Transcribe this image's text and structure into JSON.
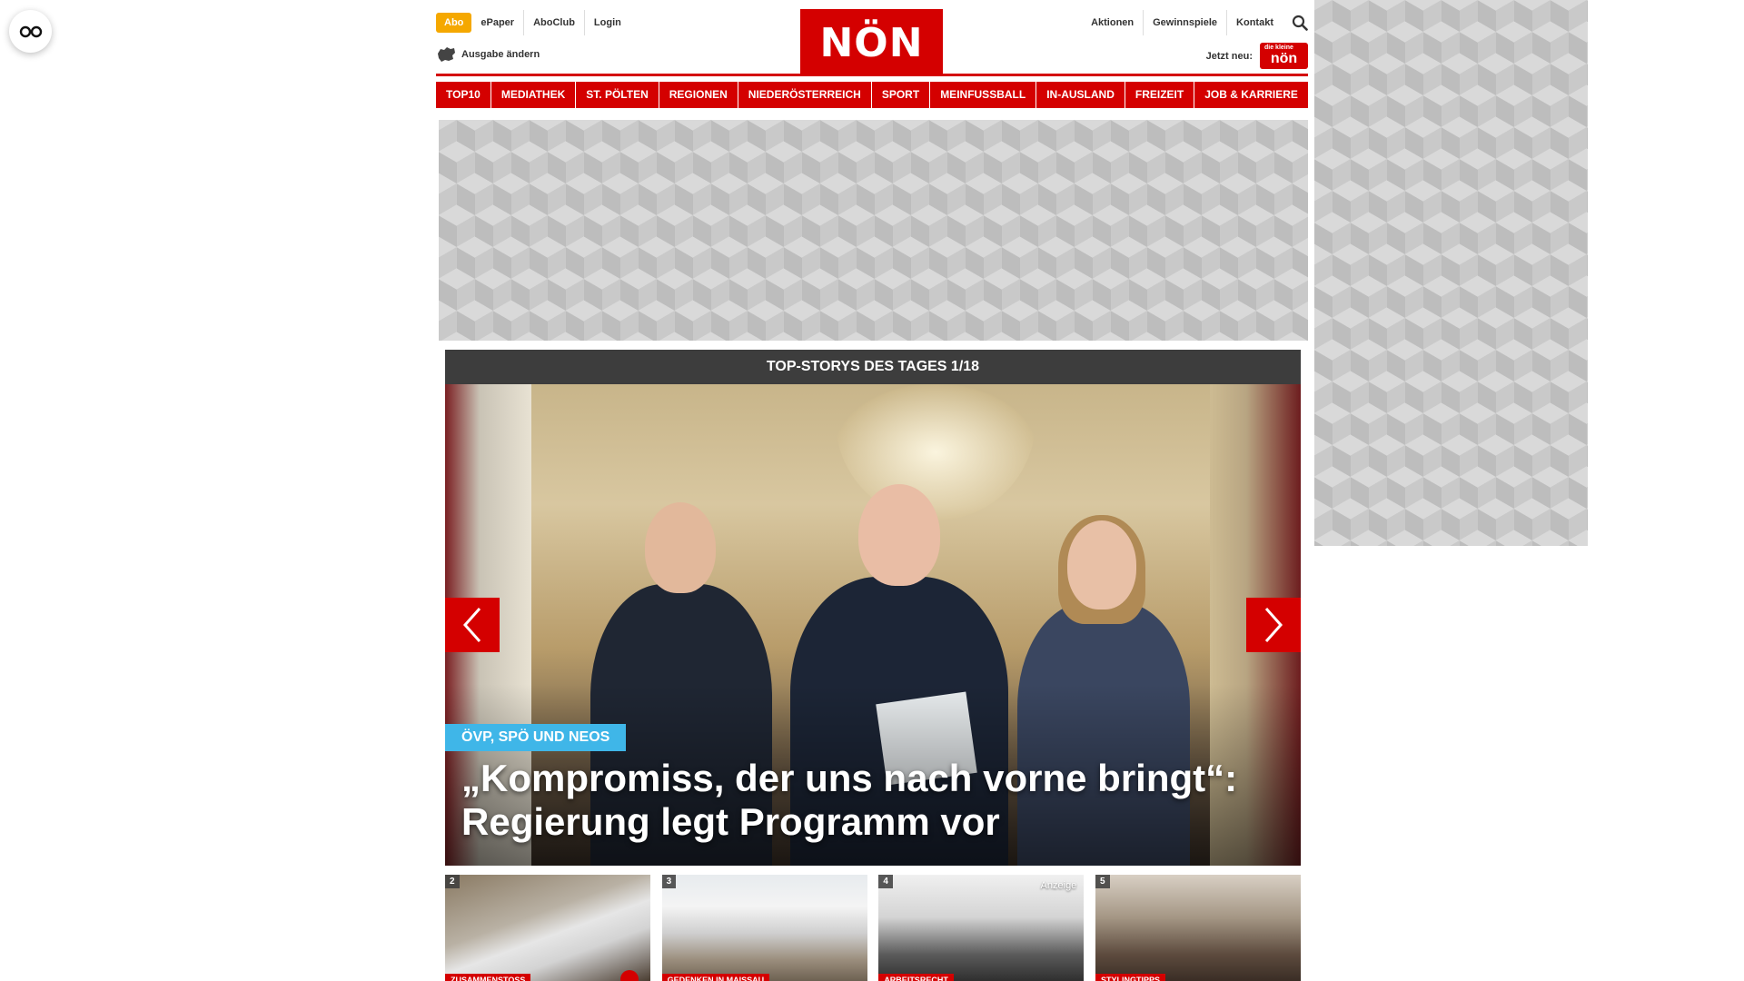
{
  "floating": {
    "icon": "reader-glasses-icon"
  },
  "header": {
    "abo_label": "Abo",
    "left_links": [
      "ePaper",
      "AboClub",
      "Login"
    ],
    "ausgabe_label": "Ausgabe ändern",
    "logo_text": "NÖN",
    "right_links": [
      "Aktionen",
      "Gewinnspiele",
      "Kontakt"
    ],
    "jetzt_label": "Jetzt neu:",
    "mini_logo_small": "die kleine",
    "mini_logo_text": "nön",
    "accent_color": "#d40000",
    "abo_color": "#f5a800"
  },
  "nav": {
    "items": [
      "TOP10",
      "MEDIATHEK",
      "ST. PÖLTEN",
      "REGIONEN",
      "NIEDERÖSTERREICH",
      "SPORT",
      "MEINFUSSBALL",
      "IN-AUSLAND",
      "FREIZEIT",
      "JOB & KARRIERE"
    ]
  },
  "stories": {
    "heading": "TOP-STORYS DES TAGES 1/18",
    "hero": {
      "tag": "ÖVP, SPÖ UND NEOS",
      "title": "„Kompromiss, der uns nach vorne bringt“: Regierung legt Programm vor",
      "tag_color": "#3fb6e8"
    },
    "thumbs": [
      {
        "num": "2",
        "category": "ZUSAMMENSTOSS",
        "ad": ""
      },
      {
        "num": "3",
        "category": "GEDENKEN IN MAISSAU",
        "ad": ""
      },
      {
        "num": "4",
        "category": "ARBEITSRECHT",
        "ad": "Anzeige"
      },
      {
        "num": "5",
        "category": "STYLINGTIPPS",
        "ad": ""
      }
    ]
  }
}
